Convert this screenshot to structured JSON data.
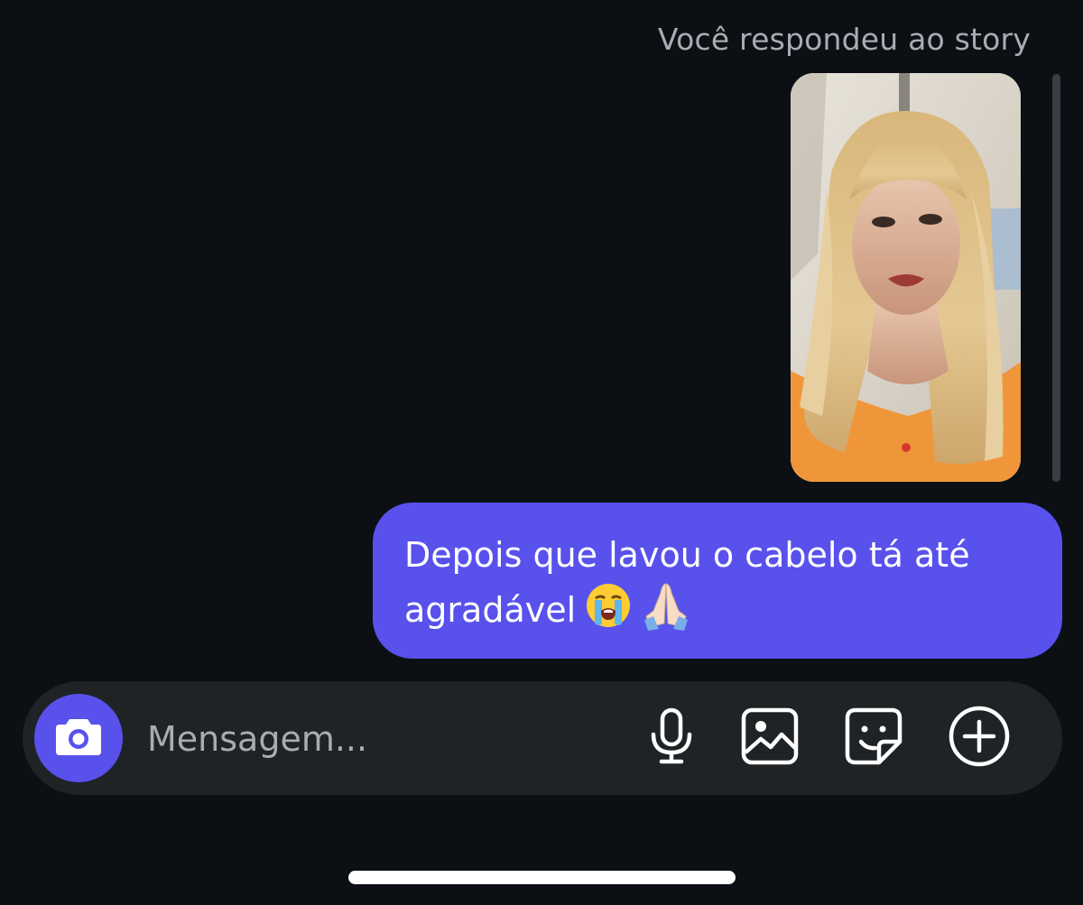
{
  "thread": {
    "reply_label": "Você respondeu ao story",
    "story_thumbnail_icon": "story-photo",
    "message_text_line1": "Depois que lavou o cabelo tá até",
    "message_text_line2": "agradável",
    "message_emojis": [
      "loudly-crying-face",
      "folded-hands"
    ]
  },
  "composer": {
    "placeholder": "Mensagem...",
    "camera_icon": "camera-icon",
    "tools": [
      "microphone-icon",
      "image-icon",
      "sticker-icon",
      "plus-circle-icon"
    ]
  },
  "colors": {
    "background": "#0c1014",
    "accent": "#5851ec",
    "composer": "#1f2326",
    "secondary_text": "#a8adb3"
  }
}
